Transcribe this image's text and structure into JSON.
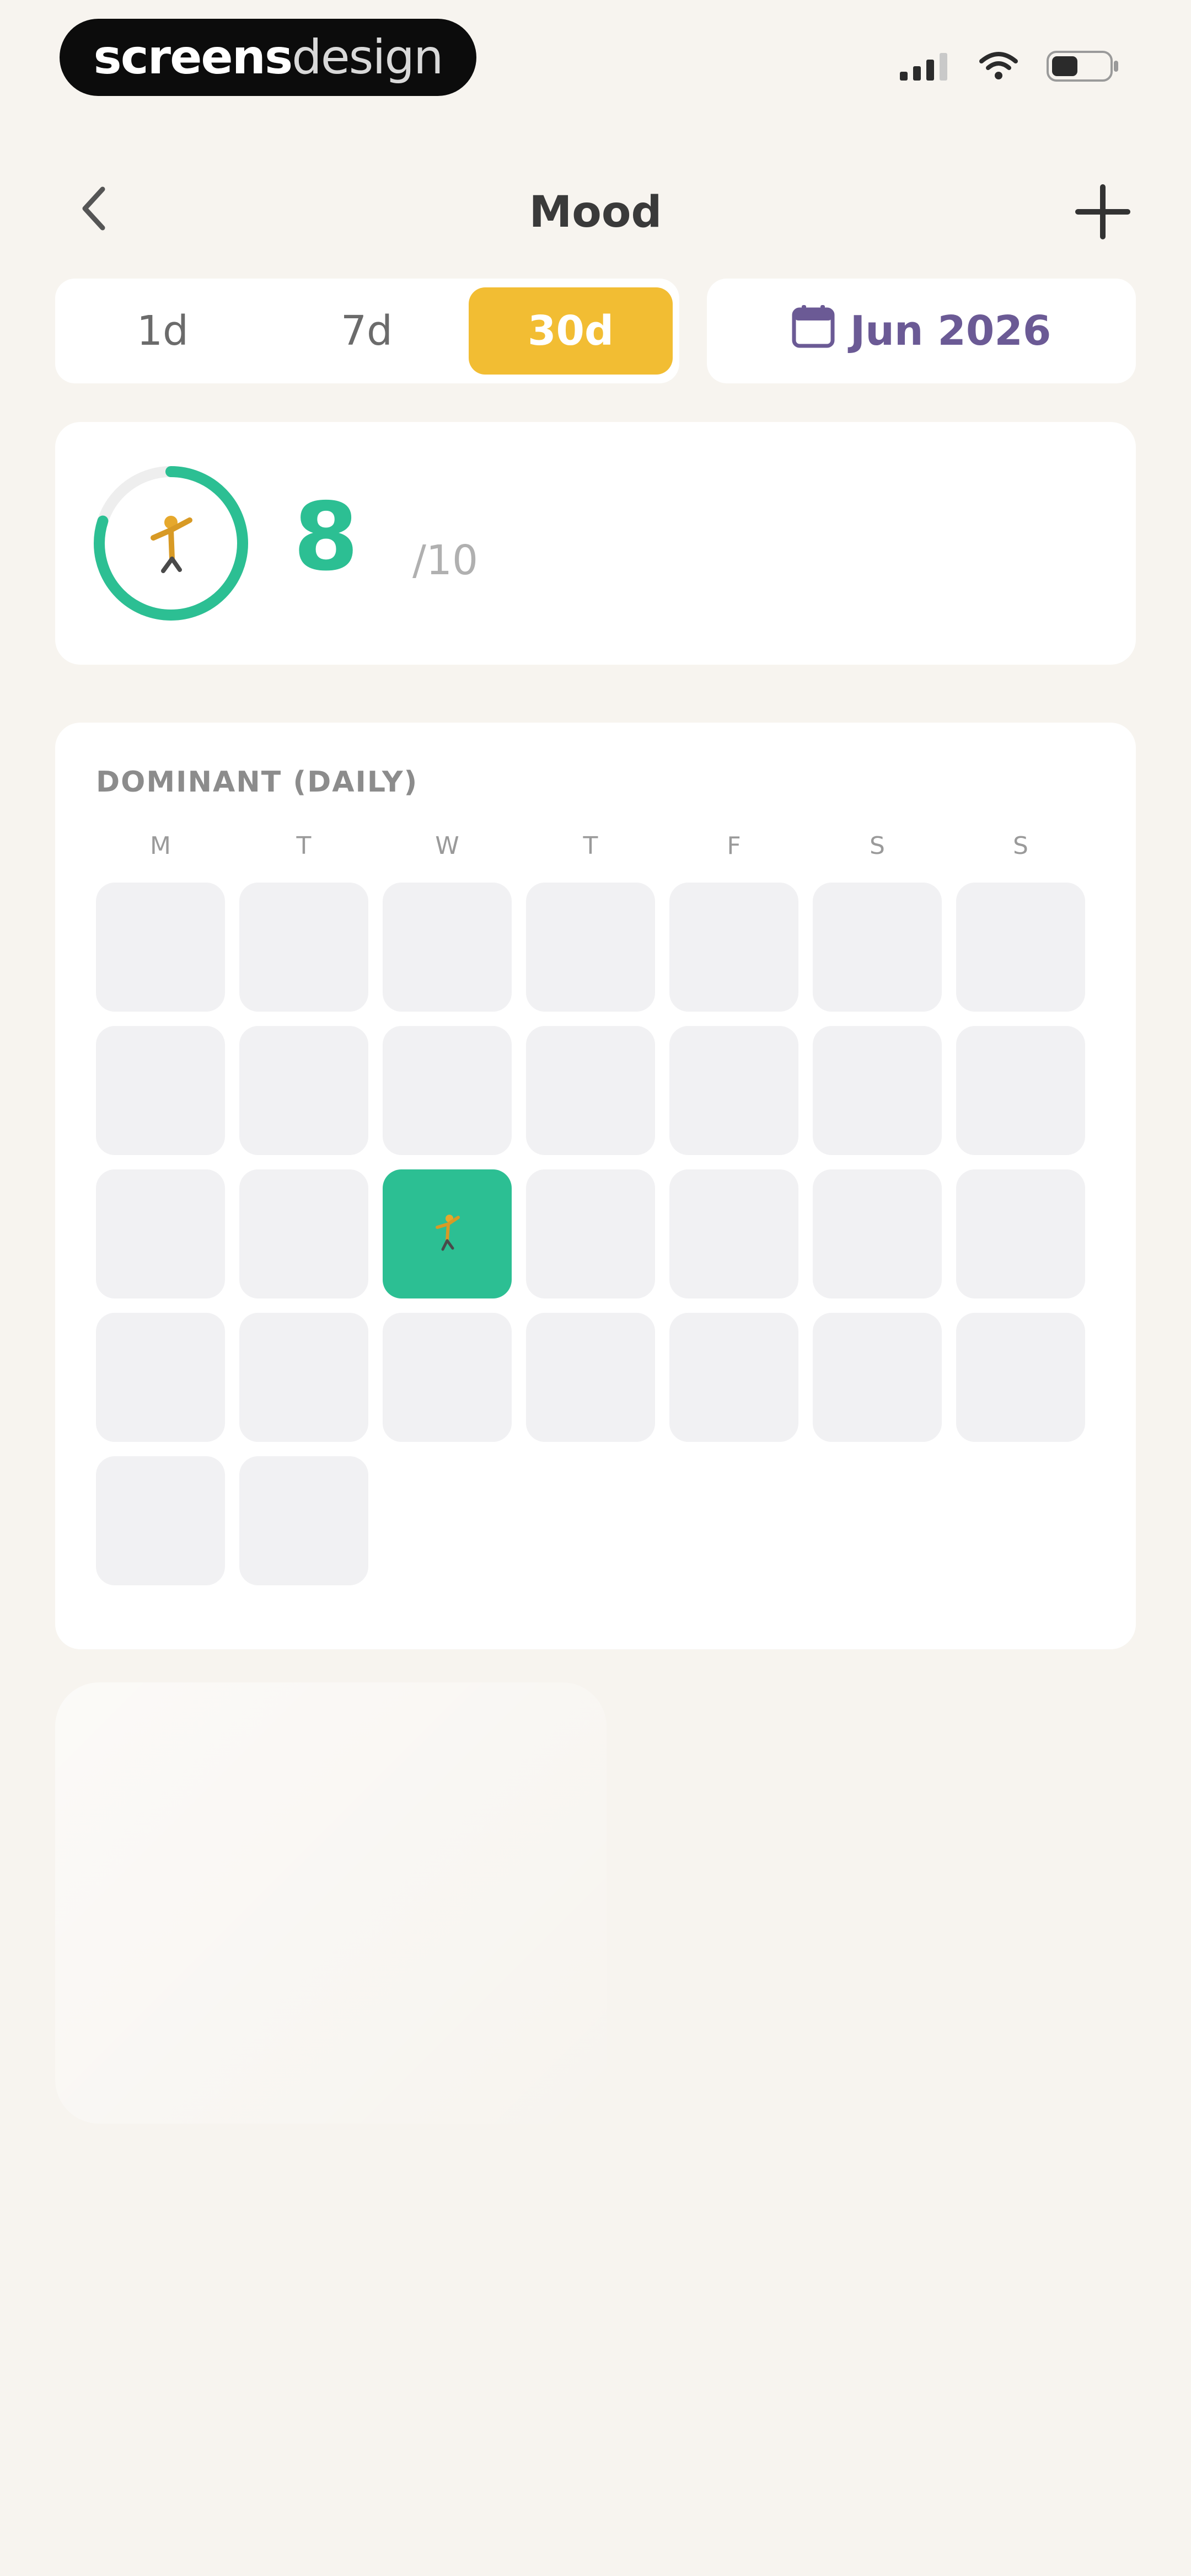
{
  "status_bar": {
    "brand_bold": "screens",
    "brand_light": "design",
    "icons": [
      "signal-icon",
      "wifi-icon",
      "battery-icon"
    ]
  },
  "nav": {
    "title": "Mood",
    "back_icon": "chevron-left-icon",
    "add_icon": "plus-icon"
  },
  "range_tabs": [
    {
      "label": "1d",
      "active": false
    },
    {
      "label": "7d",
      "active": false
    },
    {
      "label": "30d",
      "active": true
    }
  ],
  "date_chip": {
    "label": "Jun 2026",
    "icon": "calendar-icon"
  },
  "score": {
    "value": "8",
    "suffix": "/10",
    "progress": 0.8,
    "icon": "mood-figure-icon"
  },
  "dominant": {
    "label": "DOMINANT (DAILY)",
    "weekdays": [
      "M",
      "T",
      "W",
      "T",
      "F",
      "S",
      "S"
    ],
    "cells": 30,
    "highlighted_cell_index": 16
  },
  "colors": {
    "accent": "#f2bd33",
    "mood_green": "#2cbf93",
    "date_purple": "#6b5a95",
    "background": "#f7f4ef"
  }
}
